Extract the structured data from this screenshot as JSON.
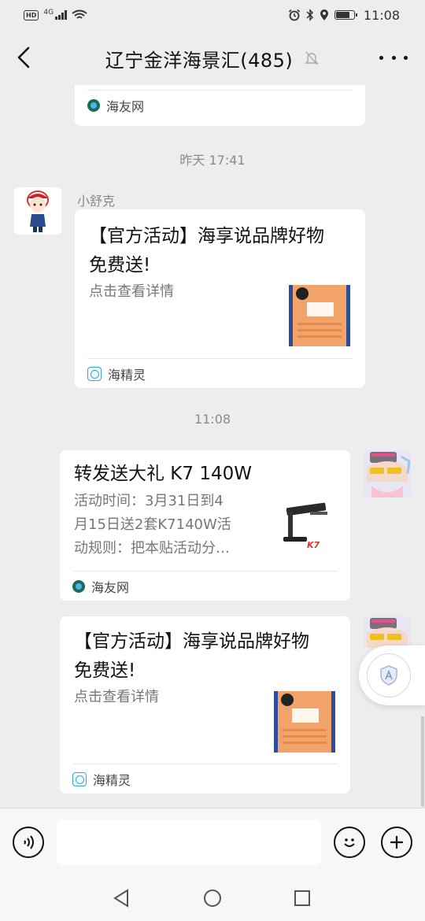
{
  "status_bar": {
    "network": "4G",
    "time": "11:08"
  },
  "header": {
    "title": "辽宁金洋海景汇(485)"
  },
  "messages": {
    "top_partial": {
      "source": "海友网"
    },
    "timestamp_1": "昨天 17:41",
    "msg1": {
      "sender": "小舒克",
      "title_line1": "【官方活动】海享说品牌好物",
      "title_line2": "免费送!",
      "desc": "点击查看详情",
      "source": "海精灵"
    },
    "timestamp_2": "11:08",
    "msg2": {
      "title": "转发送大礼 K7 140W",
      "desc_line1": "活动时间：3月31日到4",
      "desc_line2": "月15日送2套K7140W活",
      "desc_line3": "动规则：把本贴活动分…",
      "source": "海友网",
      "thumb_text": "K7"
    },
    "msg3": {
      "title_line1": "【官方活动】海享说品牌好物",
      "title_line2": "免费送!",
      "desc": "点击查看详情",
      "source": "海精灵"
    }
  },
  "colors": {
    "background": "#ededed",
    "card": "#ffffff",
    "thumb_orange": "#f2a36a",
    "thumb_blue": "#2e4c9c"
  }
}
